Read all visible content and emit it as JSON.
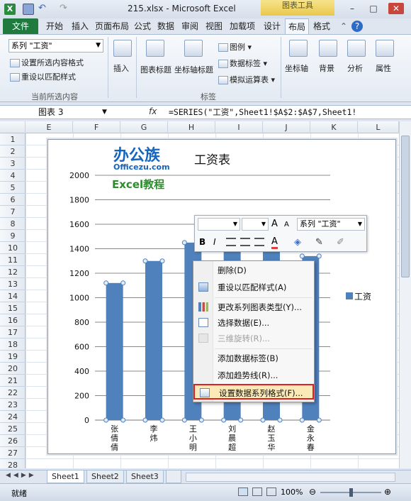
{
  "window": {
    "title": "215.xlsx - Microsoft Excel",
    "context_tab_group": "图表工具",
    "controls": [
      "–",
      "□",
      "✕"
    ]
  },
  "tabs": [
    "文件",
    "开始",
    "插入",
    "页面布局",
    "公式",
    "数据",
    "审阅",
    "视图",
    "加载项",
    "设计",
    "布局",
    "格式"
  ],
  "ribbon": {
    "selection_dropdown": "系列 \"工资\"",
    "format_selection": "设置所选内容格式",
    "reset_match_style": "重设以匹配样式",
    "group_current_selection": "当前所选内容",
    "insert": "插入",
    "chart_title": "图表标题",
    "axis_title": "坐标轴标题",
    "legend": "图例",
    "data_labels": "数据标签",
    "data_table": "模拟运算表",
    "group_labels": "标签",
    "axes": "坐标轴",
    "background": "背景",
    "analysis": "分析",
    "properties": "属性"
  },
  "formula_bar": {
    "name_box": "图表 3",
    "fx": "fx",
    "formula": "=SERIES(\"工资\",Sheet1!$A$2:$A$7,Sheet1!"
  },
  "columns": [
    "E",
    "F",
    "G",
    "H",
    "I",
    "J",
    "K",
    "L"
  ],
  "rows": [
    "1",
    "2",
    "3",
    "4",
    "5",
    "6",
    "7",
    "8",
    "9",
    "10",
    "11",
    "12",
    "13",
    "14",
    "15",
    "16",
    "17",
    "18",
    "19",
    "20",
    "21",
    "22",
    "23",
    "24",
    "25",
    "26",
    "27",
    "28"
  ],
  "watermark": {
    "brand": "办公族",
    "site": "Officezu.com",
    "tutorial": "Excel教程"
  },
  "chart_data": {
    "type": "bar",
    "title": "工资表",
    "categories": [
      "张倩倩",
      "李炜",
      "王小明",
      "刘晨超",
      "赵玉华",
      "金永春"
    ],
    "series": [
      {
        "name": "工资",
        "values": [
          1120,
          1300,
          1450,
          1470,
          1420,
          1340
        ],
        "color": "#4f81bd"
      }
    ],
    "ylim": [
      0,
      2000
    ],
    "yticks": [
      "0",
      "200",
      "400",
      "600",
      "800",
      "1000",
      "1200",
      "1400",
      "1600",
      "1800",
      "2000"
    ],
    "grid": true,
    "legend": "right"
  },
  "mini_toolbar": {
    "series_name": "系列 \"工资\"",
    "grow_font": "A",
    "shrink_font": "A",
    "bold": "B",
    "italic": "I",
    "font_color": "A"
  },
  "context_menu": [
    {
      "label": "删除(D)",
      "enabled": true
    },
    {
      "label": "重设以匹配样式(A)",
      "enabled": true
    },
    {
      "label": "更改系列图表类型(Y)...",
      "enabled": true
    },
    {
      "label": "选择数据(E)...",
      "enabled": true
    },
    {
      "label": "三维旋转(R)...",
      "enabled": false
    },
    {
      "label": "添加数据标签(B)",
      "enabled": true
    },
    {
      "label": "添加趋势线(R)...",
      "enabled": true
    },
    {
      "label": "设置数据系列格式(F)...",
      "enabled": true
    }
  ],
  "sheets": [
    "Sheet1",
    "Sheet2",
    "Sheet3"
  ],
  "status": {
    "ready": "就绪",
    "zoom": "100%"
  }
}
